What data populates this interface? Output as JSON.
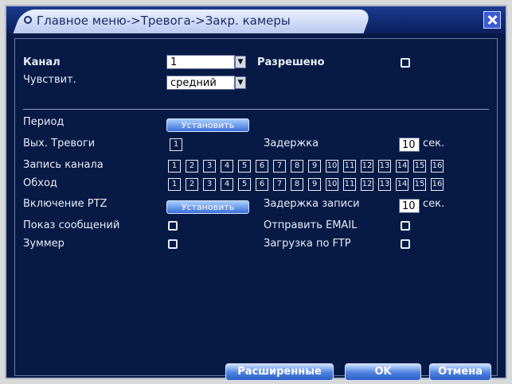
{
  "title": "Главное меню->Тревога->Закр. камеры",
  "channel": {
    "label": "Канал",
    "value": "1"
  },
  "enabled": {
    "label": "Разрешено",
    "checked": false
  },
  "sensitivity": {
    "label": "Чувствит.",
    "value": "средний"
  },
  "period": {
    "label": "Период",
    "button": "Установить"
  },
  "alarm_out": {
    "label": "Вых. Тревоги",
    "value": "1"
  },
  "delay": {
    "label": "Задержка",
    "value": "10",
    "unit": "сек."
  },
  "record_channel": {
    "label": "Запись канала",
    "channels": [
      "1",
      "2",
      "3",
      "4",
      "5",
      "6",
      "7",
      "8",
      "9",
      "10",
      "11",
      "12",
      "13",
      "14",
      "15",
      "16"
    ]
  },
  "tour": {
    "label": "Обход",
    "channels": [
      "1",
      "2",
      "3",
      "4",
      "5",
      "6",
      "7",
      "8",
      "9",
      "10",
      "11",
      "12",
      "13",
      "14",
      "15",
      "16"
    ]
  },
  "ptz": {
    "label": "Включение PTZ",
    "button": "Установить"
  },
  "record_delay": {
    "label": "Задержка записи",
    "value": "10",
    "unit": "сек."
  },
  "show_message": {
    "label": "Показ сообщений",
    "checked": false
  },
  "send_email": {
    "label": "Отправить EMAIL",
    "checked": false
  },
  "buzzer": {
    "label": "Зуммер",
    "checked": false
  },
  "ftp_upload": {
    "label": "Загрузка по FTP",
    "checked": false
  },
  "buttons": {
    "advanced": "Расширенные",
    "ok": "OK",
    "cancel": "Отмена"
  },
  "colors": {
    "window": "#071a45",
    "accent": "#3a6fd9",
    "text": "#e8ecf5"
  }
}
